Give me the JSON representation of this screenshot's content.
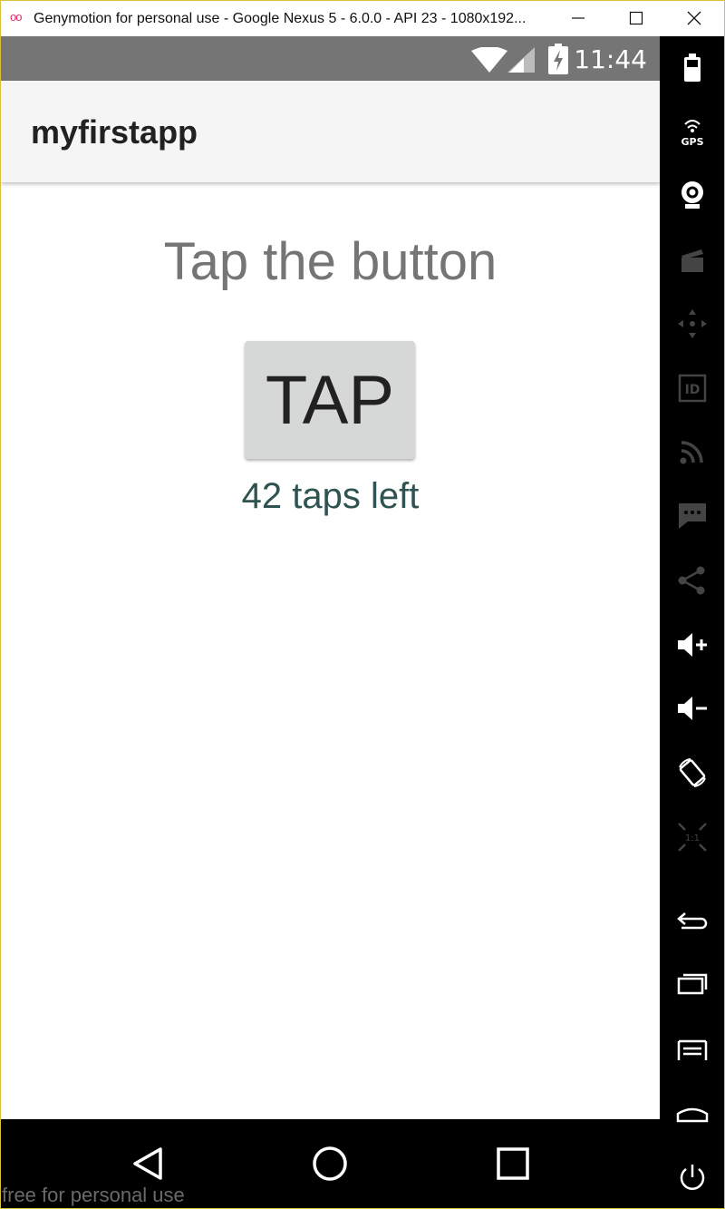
{
  "window": {
    "title": "Genymotion for personal use - Google Nexus 5 - 6.0.0 - API 23 - 1080x192...",
    "logo_glyph": "oo"
  },
  "statusbar": {
    "time": "11:44"
  },
  "app": {
    "title": "myfirstapp",
    "prompt": "Tap the button",
    "button_label": "TAP",
    "taps_left": "42 taps left"
  },
  "sidebar": {
    "gps_label": "GPS",
    "id_label": "ID",
    "ratio_label": "1:1",
    "icons": [
      "battery-icon",
      "gps-icon",
      "webcam-icon",
      "capture-icon",
      "dpad-icon",
      "device-id-icon",
      "rss-icon",
      "sms-icon",
      "share-icon",
      "volume-up-icon",
      "volume-down-icon",
      "rotate-icon",
      "pixel-perfect-icon",
      "back-icon",
      "recent-apps-icon",
      "menu-icon",
      "home-icon",
      "power-icon"
    ]
  },
  "navbar": {
    "buttons": [
      "back",
      "home",
      "recents"
    ]
  },
  "watermark": "free for personal use"
}
